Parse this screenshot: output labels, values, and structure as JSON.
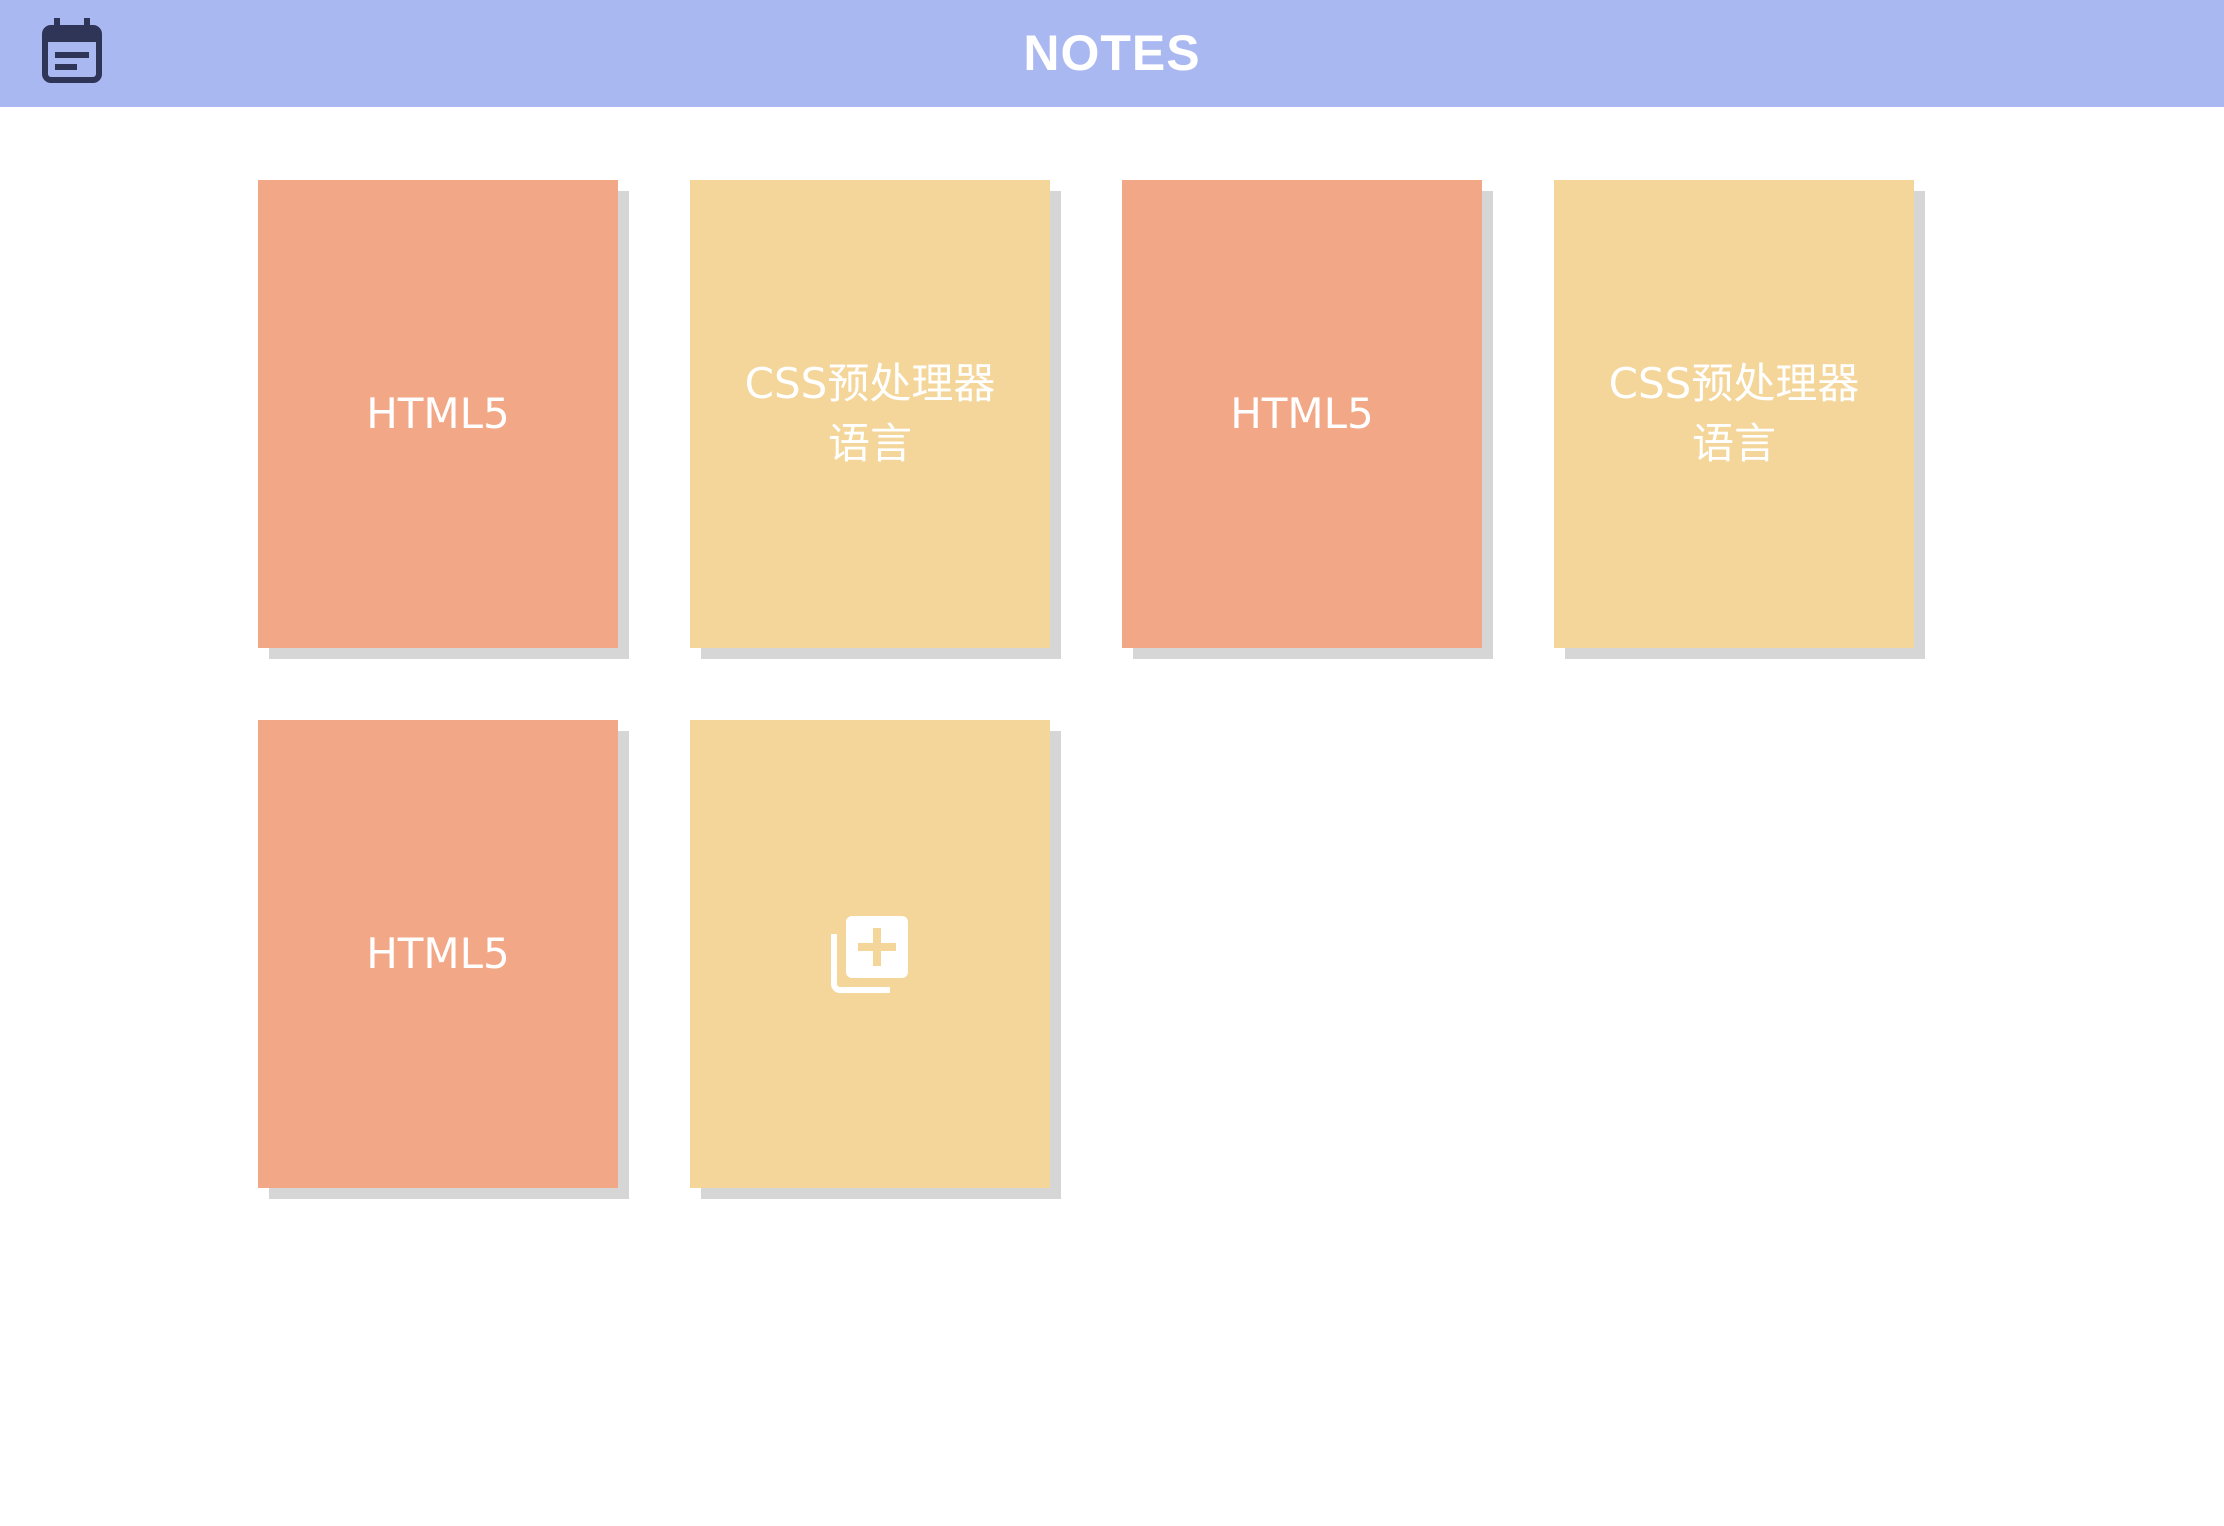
{
  "header": {
    "title": "NOTES",
    "icon": "notes-calendar-icon",
    "background": "#aab8f2",
    "icon_color": "#2e3557"
  },
  "colors": {
    "salmon": "#f2a787",
    "yellow": "#f4d59a",
    "shadow": "#d6d6d6"
  },
  "notes": [
    {
      "text": "HTML5",
      "color": "salmon"
    },
    {
      "text": "CSS预处理器\n语言",
      "color": "yellow"
    },
    {
      "text": "HTML5",
      "color": "salmon"
    },
    {
      "text": "CSS预处理器\n语言",
      "color": "yellow"
    },
    {
      "text": "HTML5",
      "color": "salmon"
    }
  ],
  "add_card": {
    "icon": "add-note-icon",
    "color": "yellow"
  }
}
